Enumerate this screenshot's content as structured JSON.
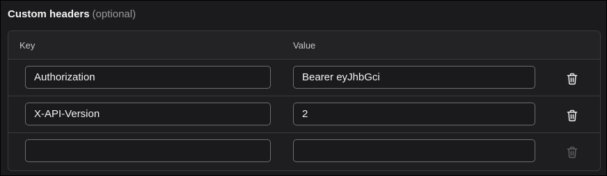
{
  "section": {
    "title": "Custom headers",
    "optional_note": "(optional)"
  },
  "table": {
    "columns": {
      "key": "Key",
      "value": "Value"
    },
    "rows": [
      {
        "key": "Authorization",
        "value": "Bearer eyJhbGci",
        "delete_enabled": true
      },
      {
        "key": "X-API-Version",
        "value": "2",
        "delete_enabled": true
      },
      {
        "key": "",
        "value": "",
        "delete_enabled": false
      }
    ]
  },
  "icons": {
    "delete": "trash-icon"
  },
  "colors": {
    "background": "#1b1b1d",
    "border": "#3a3a3e",
    "input_border": "#6e6e74",
    "text": "#f2f2f2",
    "muted": "#9a9aa0",
    "icon_enabled": "#e6e6e8",
    "icon_disabled": "#5c5c62"
  }
}
